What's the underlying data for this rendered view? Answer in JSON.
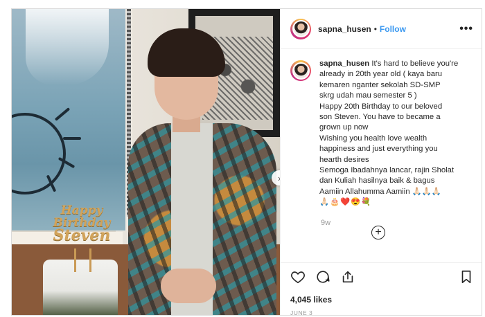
{
  "post": {
    "username": "sapna_husen",
    "follow_separator": "•",
    "follow_label": "Follow",
    "more_label": "•••",
    "next_label": "›"
  },
  "photo": {
    "topper_line1": "Happy",
    "topper_line2": "Birthday",
    "topper_line3": "Steven"
  },
  "caption": {
    "username": "sapna_husen",
    "lines": [
      "It's hard to believe you're",
      "already in 20th year old ( kaya baru",
      "kemaren nganter sekolah SD-SMP",
      "skrg udah mau semester 5 )",
      "Happy 20th Birthday to our beloved",
      "son Steven. You have to became a",
      "grown up now",
      "Wishing you health love wealth",
      "happiness and just everything you",
      "hearth desires",
      "Semoga Ibadahnya lancar, rajin Sholat",
      "dan Kuliah hasilnya baik & bagus",
      "Aamiin Allahumma Aamiin 🙏🏻🙏🏻🙏🏻"
    ],
    "emoji_line": "🙏🏻🎂❤️😍💐",
    "age": "9w"
  },
  "load_more_label": "+",
  "footer": {
    "likes": "4,045 likes",
    "date": "JUNE 3"
  }
}
